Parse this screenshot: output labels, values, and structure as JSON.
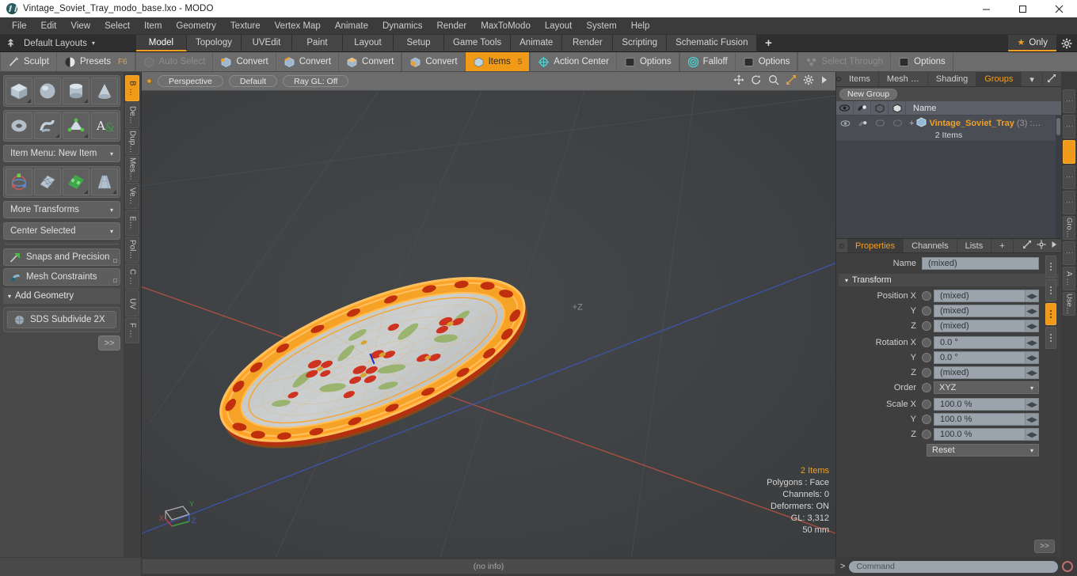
{
  "window": {
    "title": "Vintage_Soviet_Tray_modo_base.lxo - MODO",
    "logo_icon": "modo-logo-icon",
    "minimize": "−",
    "maximize": "□",
    "close": "✕"
  },
  "menubar": {
    "items": [
      "File",
      "Edit",
      "View",
      "Select",
      "Item",
      "Geometry",
      "Texture",
      "Vertex Map",
      "Animate",
      "Dynamics",
      "Render",
      "MaxToModo",
      "Layout",
      "System",
      "Help"
    ]
  },
  "layoutbar": {
    "tree_icon": "layout-tree-icon",
    "default_layouts": "Default Layouts",
    "caret": "▾",
    "tabs": [
      {
        "label": "Model",
        "active": true
      },
      {
        "label": "Topology",
        "active": false
      },
      {
        "label": "UVEdit",
        "active": false
      },
      {
        "label": "Paint",
        "active": false
      },
      {
        "label": "Layout",
        "active": false
      },
      {
        "label": "Setup",
        "active": false
      },
      {
        "label": "Game Tools",
        "active": false
      },
      {
        "label": "Animate",
        "active": false
      },
      {
        "label": "Render",
        "active": false
      },
      {
        "label": "Scripting",
        "active": false
      },
      {
        "label": "Schematic Fusion",
        "active": false
      }
    ],
    "add_tab": "+",
    "only_label": "Only",
    "star_icon": "star-icon",
    "gear_icon": "gear-icon",
    "accent": "#f0a025"
  },
  "toolbar": {
    "groups": [
      [
        {
          "label": "Sculpt",
          "icon": "sculpt-brush-icon",
          "state": "normal"
        },
        {
          "label": "Presets",
          "icon": "presets-sphere-icon",
          "state": "normal",
          "hotkey": "F6"
        }
      ],
      [
        {
          "label": "Auto Select",
          "icon": "cube-grey-icon",
          "state": "dim"
        },
        {
          "label": "Convert",
          "icon": "cube-vertex-icon",
          "state": "normal"
        },
        {
          "label": "Convert",
          "icon": "cube-edge-icon",
          "state": "normal"
        },
        {
          "label": "Convert",
          "icon": "cube-poly-icon",
          "state": "normal"
        }
      ],
      [
        {
          "label": "Convert",
          "icon": "cube-material-icon",
          "state": "normal"
        },
        {
          "label": "Items",
          "icon": "items-cube-icon",
          "state": "selected",
          "hotkey": "5"
        }
      ],
      [
        {
          "label": "Action Center",
          "icon": "action-center-icon",
          "state": "normal"
        },
        {
          "label": "Options",
          "icon": "options-square-icon",
          "state": "normal"
        }
      ],
      [
        {
          "label": "Falloff",
          "icon": "falloff-icon",
          "state": "normal"
        },
        {
          "label": "Options",
          "icon": "options-square-icon",
          "state": "normal"
        }
      ],
      [
        {
          "label": "Select Through",
          "icon": "select-through-icon",
          "state": "dim"
        },
        {
          "label": "Options",
          "icon": "options-square-icon",
          "state": "normal"
        }
      ]
    ]
  },
  "left_toolbox": {
    "primitive_tiles": [
      "cube-primitive-icon",
      "sphere-primitive-icon",
      "cylinder-primitive-icon",
      "cone-primitive-icon"
    ],
    "primitive_tiles2": [
      "torus-primitive-icon",
      "helix-primitive-icon",
      "polygon-pen-icon",
      "text-tool-icon"
    ],
    "item_menu": "Item Menu: New Item",
    "transform_tiles": [
      "transform-gizmo-icon",
      "bend-tool-icon",
      "shear-tool-icon",
      "taper-tool-icon"
    ],
    "more_transforms": "More Transforms",
    "center_selected": "Center Selected",
    "snaps": "Snaps and Precision",
    "snaps_icon": "snap-magnet-icon",
    "mesh_constraints": "Mesh Constraints",
    "mesh_constraints_icon": "mesh-constraint-icon",
    "add_geometry": "Add Geometry",
    "add_geometry_tri": "▾",
    "sds_subdivide": "SDS Subdivide 2X",
    "sds_icon": "sds-sphere-icon",
    "more_button": ">>",
    "vertical_tabs": [
      {
        "label": "B …",
        "active": true
      },
      {
        "label": "De…",
        "active": false
      },
      {
        "label": "Dup…",
        "active": false
      },
      {
        "label": "Mes…",
        "active": false
      },
      {
        "label": "Ve…",
        "active": false
      },
      {
        "label": "E…",
        "active": false
      },
      {
        "label": "Pol…",
        "active": false
      },
      {
        "label": "C …",
        "active": false
      },
      {
        "label": "UV",
        "active": false
      },
      {
        "label": "F …",
        "active": false
      }
    ]
  },
  "viewport": {
    "indicator_icon": "viewport-active-dot",
    "view_mode": "Perspective",
    "shading": "Default",
    "ray_gl": "Ray GL: Off",
    "header_icons": [
      "move-icon",
      "rotate-icon",
      "zoom-icon",
      "fit-icon",
      "gear-icon",
      "play-arrow-icon"
    ],
    "stats": {
      "items": "2 Items",
      "polygons": "Polygons : Face",
      "channels": "Channels: 0",
      "deformers": "Deformers: ON",
      "gl": "GL: 3,312",
      "scale": "50 mm"
    },
    "axis_gizmo": {
      "x": "X",
      "y": "Y",
      "z": "Z"
    },
    "plus_z_label": "+Z",
    "selection_color": "#ffa326",
    "background": "#3f4143"
  },
  "right_top": {
    "tabs": [
      {
        "label": "Items",
        "active": false
      },
      {
        "label": "Mesh …",
        "active": false
      },
      {
        "label": "Shading",
        "active": false
      },
      {
        "label": "Groups",
        "active": true
      }
    ],
    "tab_caret": "▾",
    "expand_icon": "expand-icon",
    "arrow_icon": "play-arrow-icon",
    "new_group": "New Group",
    "columns": [
      "eye-icon",
      "render-icon",
      "wireframe-icon",
      "shaded-icon",
      "Name"
    ],
    "row": {
      "expand": "+",
      "item_icon": "group-item-icon",
      "name": "Vintage_Soviet_Tray",
      "count": "(3) :…",
      "subtitle": "2 Items"
    }
  },
  "properties": {
    "tabs": [
      {
        "label": "Properties",
        "active": true
      },
      {
        "label": "Channels",
        "active": false
      },
      {
        "label": "Lists",
        "active": false
      }
    ],
    "add_tab": "+",
    "expand_icon": "expand-icon",
    "gear_icon": "gear-icon",
    "arrow_icon": "play-arrow-icon",
    "name_label": "Name",
    "name_value": "(mixed)",
    "transform_header": "Transform",
    "transform_tri": "▾",
    "fields": [
      {
        "label": "Position X",
        "value": "(mixed)",
        "type": "num"
      },
      {
        "label": "Y",
        "value": "(mixed)",
        "type": "num"
      },
      {
        "label": "Z",
        "value": "(mixed)",
        "type": "num"
      },
      {
        "label": "Rotation X",
        "value": "0.0 °",
        "type": "num"
      },
      {
        "label": "Y",
        "value": "0.0 °",
        "type": "num"
      },
      {
        "label": "Z",
        "value": "(mixed)",
        "type": "num"
      },
      {
        "label": "Order",
        "value": "XYZ",
        "type": "combo"
      },
      {
        "label": "Scale X",
        "value": "100.0 %",
        "type": "num"
      },
      {
        "label": "Y",
        "value": "100.0 %",
        "type": "num"
      },
      {
        "label": "Z",
        "value": "100.0 %",
        "type": "num"
      }
    ],
    "reset": "Reset",
    "reset_caret": "▾",
    "more_button": ">>",
    "vertical_tabs": [
      {
        "label": "⋮",
        "active": false
      },
      {
        "label": "⋮",
        "active": false
      },
      {
        "label": "⋮",
        "active": true
      },
      {
        "label": "⋮",
        "active": false
      },
      {
        "label": "⋮",
        "active": false
      },
      {
        "label": "Gro…",
        "active": false
      },
      {
        "label": "⋮",
        "active": false
      },
      {
        "label": "A …",
        "active": false
      },
      {
        "label": "Use…",
        "active": false
      }
    ]
  },
  "bottom": {
    "info": "(no info)",
    "command_prompt": ">",
    "command_placeholder": "Command",
    "record_icon": "record-icon"
  }
}
